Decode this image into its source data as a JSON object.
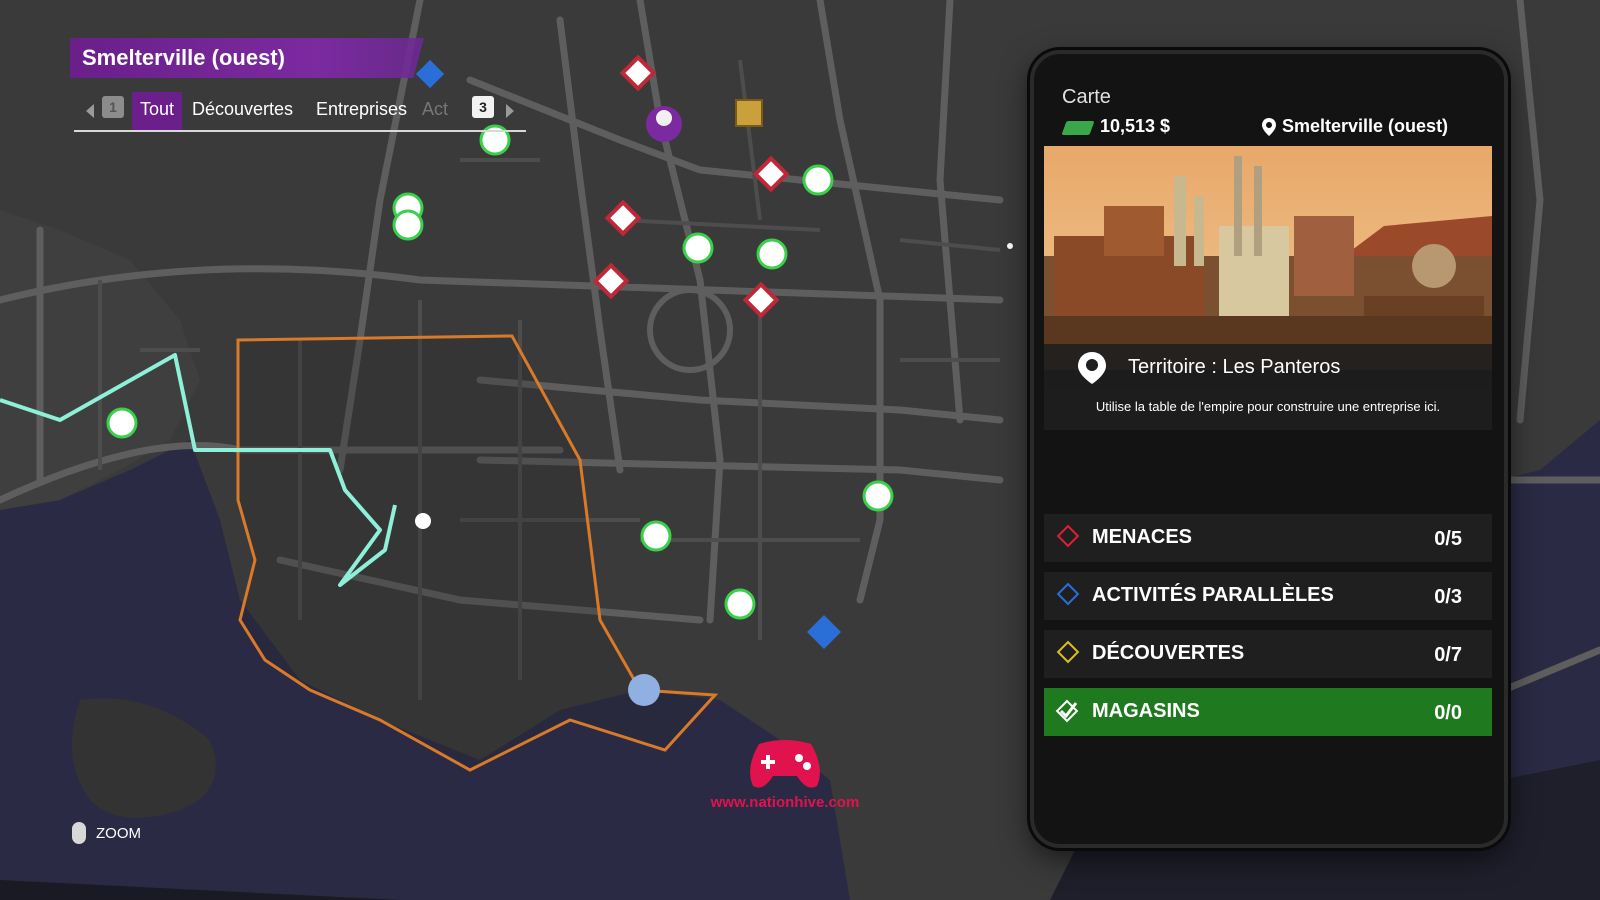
{
  "header": {
    "title": "Smelterville (ouest)",
    "prev_key": "1",
    "next_key": "3",
    "tabs": [
      "Tout",
      "Découvertes",
      "Entreprises",
      "Act"
    ],
    "active_tab": "Tout"
  },
  "panel": {
    "title": "Carte",
    "cash": "10,513 $",
    "location": "Smelterville (ouest)",
    "territory": "Territoire : Les Panteros",
    "description": "Utilise la table de l'empire pour construire une entreprise ici.",
    "stats": [
      {
        "label": "MENACES",
        "value": "0/5",
        "color": "#e02030"
      },
      {
        "label": "ACTIVITÉS PARALLÈLES",
        "value": "0/3",
        "color": "#2a6ed8"
      },
      {
        "label": "DÉCOUVERTES",
        "value": "0/7",
        "color": "#d8c020"
      },
      {
        "label": "MAGASINS",
        "value": "0/0",
        "color": "#ffffff"
      }
    ]
  },
  "footer": {
    "zoom_label": "ZOOM",
    "watermark": "www.nationhive.com"
  },
  "colors": {
    "accent_purple": "#6a1f8a",
    "route_cyan": "#8ef0d8",
    "territory_orange": "#d87a2a",
    "store_green": "#1f7a1f"
  }
}
